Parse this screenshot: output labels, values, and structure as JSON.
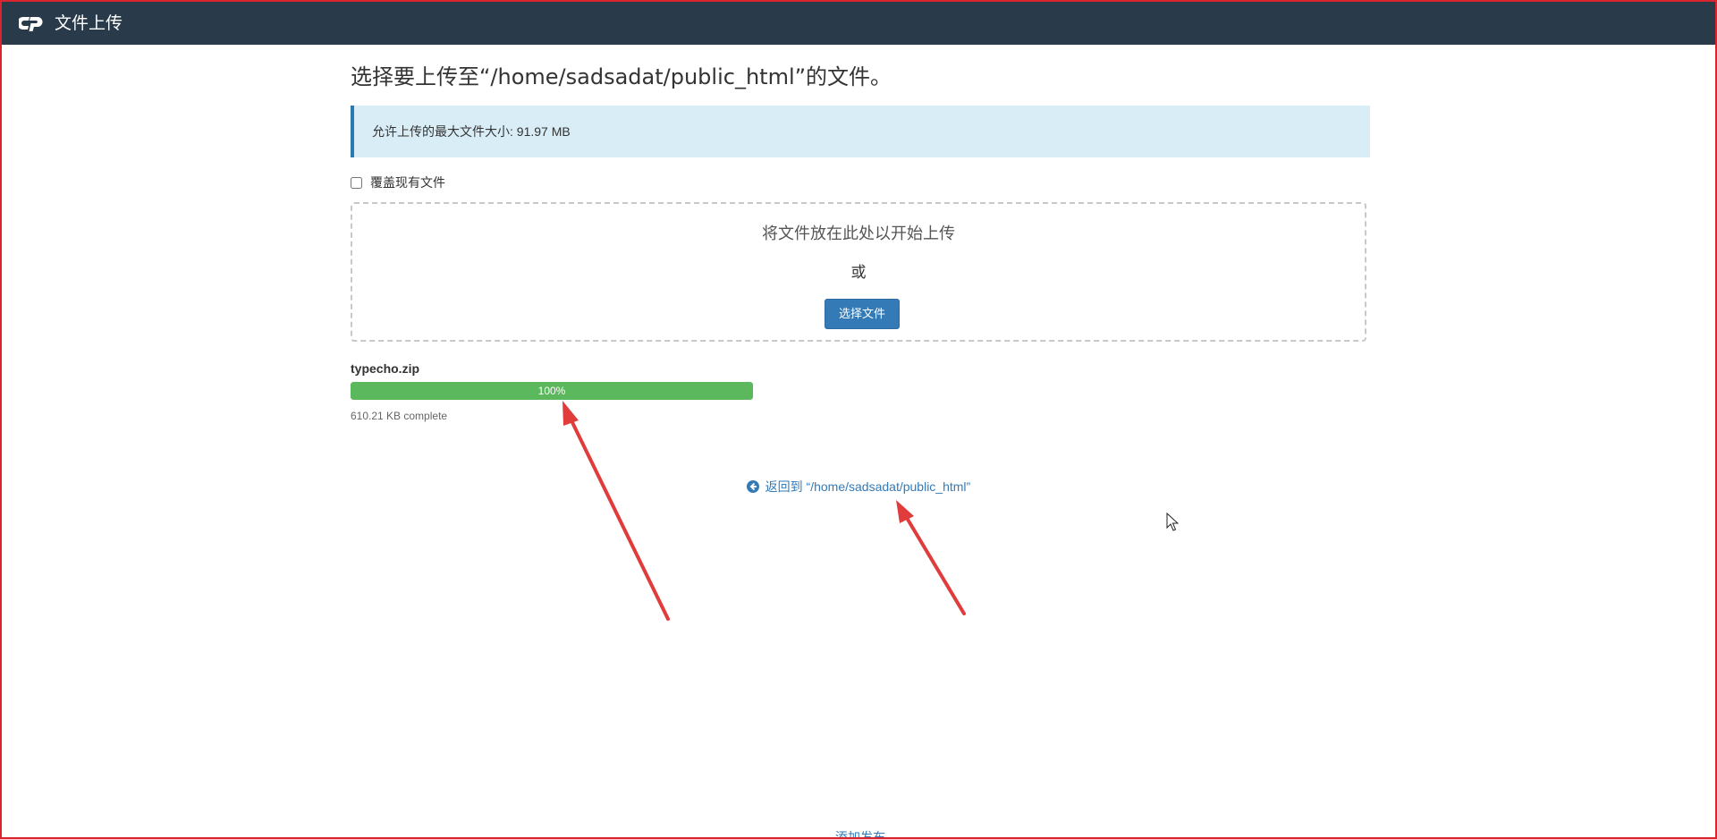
{
  "app": {
    "title": "文件上传"
  },
  "page": {
    "heading": "选择要上传至“/home/sadsadat/public_html”的文件。",
    "max_size_notice": "允许上传的最大文件大小: 91.97 MB",
    "overwrite_label": "覆盖现有文件",
    "overwrite_checked": false,
    "dropzone": {
      "drop_text": "将文件放在此处以开始上传",
      "or_text": "或",
      "select_button": "选择文件"
    },
    "upload": {
      "file_name": "typecho.zip",
      "progress_label": "100%",
      "progress_fraction": 1.0,
      "status_text": "610.21 KB complete"
    },
    "back_link": "返回到 “/home/sadsadat/public_html”",
    "footer_link": "添加发布"
  },
  "colors": {
    "topbar": "#293a4a",
    "accent": "#337ab7",
    "progress": "#5cb85c",
    "alert_bg": "#d9edf7",
    "annotation_arrow": "#e03c3c",
    "frame_border": "#d9262e"
  },
  "icons": {
    "logo": "cpanel-logo-icon",
    "back": "arrow-circle-left-icon",
    "cursor": "mouse-pointer-icon"
  }
}
